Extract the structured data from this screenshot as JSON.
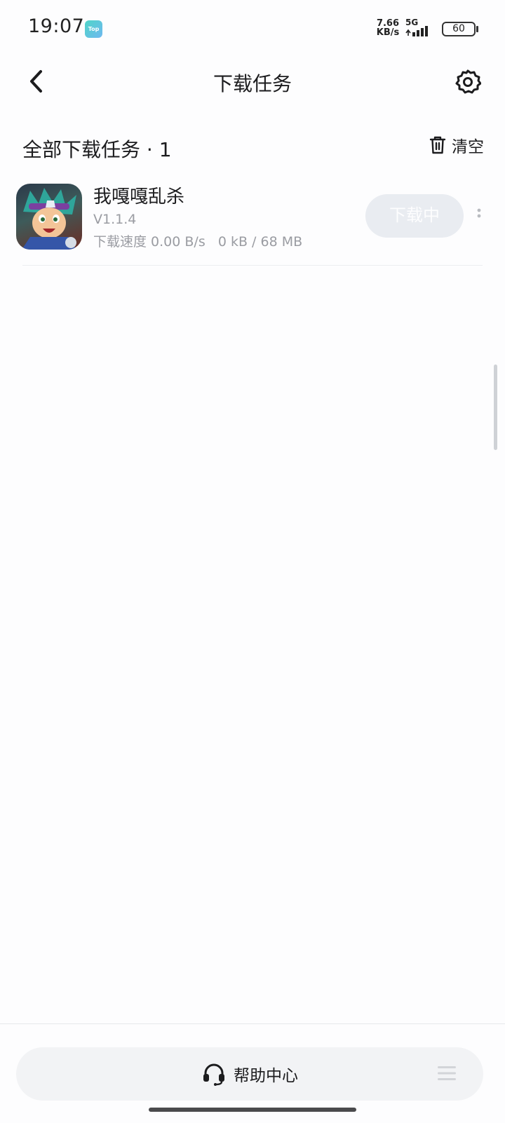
{
  "status_bar": {
    "time": "19:07",
    "app_badge": "Top",
    "net_speed_value": "7.66",
    "net_speed_unit": "KB/s",
    "net_type": "5G",
    "battery": "60"
  },
  "header": {
    "title": "下载任务",
    "back_icon": "chevron-left-icon",
    "settings_icon": "gear-icon"
  },
  "section": {
    "title": "全部下载任务 · 1",
    "clear_label": "清空",
    "clear_icon": "trash-icon"
  },
  "tasks": [
    {
      "name": "我嘎嘎乱杀",
      "version": "V1.1.4",
      "progress": "下载速度 0.00 B/s   0 kB / 68 MB",
      "button_label": "下载中"
    }
  ],
  "bottom": {
    "help_label": "帮助中心",
    "help_icon": "headset-icon",
    "menu_icon": "menu-icon"
  },
  "colors": {
    "accent_bg": "#e9ecf1",
    "muted_text": "#9a9ca2",
    "app_badge": "#4fd5c8"
  }
}
